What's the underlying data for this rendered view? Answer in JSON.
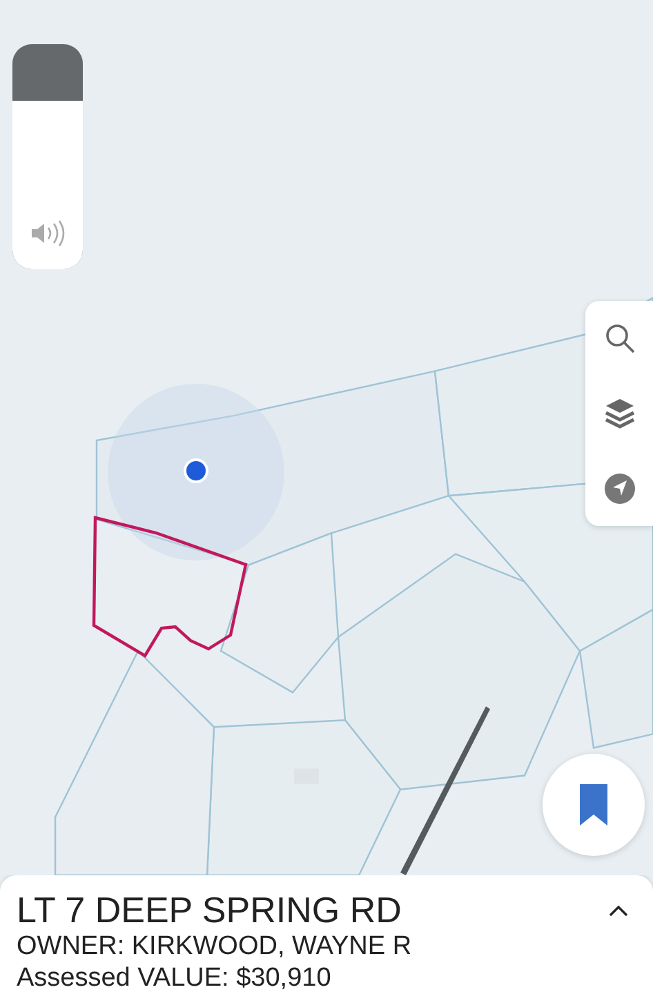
{
  "volume_hud": {
    "level": 0.75
  },
  "map_tools": [
    {
      "kind": "search"
    },
    {
      "kind": "layers"
    },
    {
      "kind": "locate"
    }
  ],
  "parcel": {
    "address": "LT 7 DEEP SPRING RD",
    "owner": "OWNER: KIRKWOOD, WAYNE R",
    "assessed": "Assessed VALUE: $30,910",
    "expanded": false
  }
}
